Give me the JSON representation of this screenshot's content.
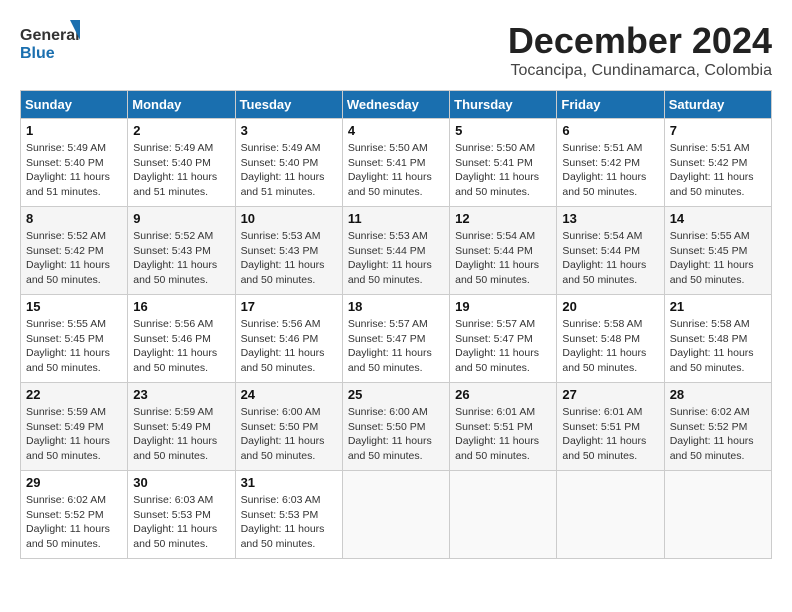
{
  "header": {
    "logo_line1": "General",
    "logo_line2": "Blue",
    "month_title": "December 2024",
    "location": "Tocancipa, Cundinamarca, Colombia"
  },
  "weekdays": [
    "Sunday",
    "Monday",
    "Tuesday",
    "Wednesday",
    "Thursday",
    "Friday",
    "Saturday"
  ],
  "weeks": [
    [
      {
        "day": 1,
        "info": "Sunrise: 5:49 AM\nSunset: 5:40 PM\nDaylight: 11 hours\nand 51 minutes."
      },
      {
        "day": 2,
        "info": "Sunrise: 5:49 AM\nSunset: 5:40 PM\nDaylight: 11 hours\nand 51 minutes."
      },
      {
        "day": 3,
        "info": "Sunrise: 5:49 AM\nSunset: 5:40 PM\nDaylight: 11 hours\nand 51 minutes."
      },
      {
        "day": 4,
        "info": "Sunrise: 5:50 AM\nSunset: 5:41 PM\nDaylight: 11 hours\nand 50 minutes."
      },
      {
        "day": 5,
        "info": "Sunrise: 5:50 AM\nSunset: 5:41 PM\nDaylight: 11 hours\nand 50 minutes."
      },
      {
        "day": 6,
        "info": "Sunrise: 5:51 AM\nSunset: 5:42 PM\nDaylight: 11 hours\nand 50 minutes."
      },
      {
        "day": 7,
        "info": "Sunrise: 5:51 AM\nSunset: 5:42 PM\nDaylight: 11 hours\nand 50 minutes."
      }
    ],
    [
      {
        "day": 8,
        "info": "Sunrise: 5:52 AM\nSunset: 5:42 PM\nDaylight: 11 hours\nand 50 minutes."
      },
      {
        "day": 9,
        "info": "Sunrise: 5:52 AM\nSunset: 5:43 PM\nDaylight: 11 hours\nand 50 minutes."
      },
      {
        "day": 10,
        "info": "Sunrise: 5:53 AM\nSunset: 5:43 PM\nDaylight: 11 hours\nand 50 minutes."
      },
      {
        "day": 11,
        "info": "Sunrise: 5:53 AM\nSunset: 5:44 PM\nDaylight: 11 hours\nand 50 minutes."
      },
      {
        "day": 12,
        "info": "Sunrise: 5:54 AM\nSunset: 5:44 PM\nDaylight: 11 hours\nand 50 minutes."
      },
      {
        "day": 13,
        "info": "Sunrise: 5:54 AM\nSunset: 5:44 PM\nDaylight: 11 hours\nand 50 minutes."
      },
      {
        "day": 14,
        "info": "Sunrise: 5:55 AM\nSunset: 5:45 PM\nDaylight: 11 hours\nand 50 minutes."
      }
    ],
    [
      {
        "day": 15,
        "info": "Sunrise: 5:55 AM\nSunset: 5:45 PM\nDaylight: 11 hours\nand 50 minutes."
      },
      {
        "day": 16,
        "info": "Sunrise: 5:56 AM\nSunset: 5:46 PM\nDaylight: 11 hours\nand 50 minutes."
      },
      {
        "day": 17,
        "info": "Sunrise: 5:56 AM\nSunset: 5:46 PM\nDaylight: 11 hours\nand 50 minutes."
      },
      {
        "day": 18,
        "info": "Sunrise: 5:57 AM\nSunset: 5:47 PM\nDaylight: 11 hours\nand 50 minutes."
      },
      {
        "day": 19,
        "info": "Sunrise: 5:57 AM\nSunset: 5:47 PM\nDaylight: 11 hours\nand 50 minutes."
      },
      {
        "day": 20,
        "info": "Sunrise: 5:58 AM\nSunset: 5:48 PM\nDaylight: 11 hours\nand 50 minutes."
      },
      {
        "day": 21,
        "info": "Sunrise: 5:58 AM\nSunset: 5:48 PM\nDaylight: 11 hours\nand 50 minutes."
      }
    ],
    [
      {
        "day": 22,
        "info": "Sunrise: 5:59 AM\nSunset: 5:49 PM\nDaylight: 11 hours\nand 50 minutes."
      },
      {
        "day": 23,
        "info": "Sunrise: 5:59 AM\nSunset: 5:49 PM\nDaylight: 11 hours\nand 50 minutes."
      },
      {
        "day": 24,
        "info": "Sunrise: 6:00 AM\nSunset: 5:50 PM\nDaylight: 11 hours\nand 50 minutes."
      },
      {
        "day": 25,
        "info": "Sunrise: 6:00 AM\nSunset: 5:50 PM\nDaylight: 11 hours\nand 50 minutes."
      },
      {
        "day": 26,
        "info": "Sunrise: 6:01 AM\nSunset: 5:51 PM\nDaylight: 11 hours\nand 50 minutes."
      },
      {
        "day": 27,
        "info": "Sunrise: 6:01 AM\nSunset: 5:51 PM\nDaylight: 11 hours\nand 50 minutes."
      },
      {
        "day": 28,
        "info": "Sunrise: 6:02 AM\nSunset: 5:52 PM\nDaylight: 11 hours\nand 50 minutes."
      }
    ],
    [
      {
        "day": 29,
        "info": "Sunrise: 6:02 AM\nSunset: 5:52 PM\nDaylight: 11 hours\nand 50 minutes."
      },
      {
        "day": 30,
        "info": "Sunrise: 6:03 AM\nSunset: 5:53 PM\nDaylight: 11 hours\nand 50 minutes."
      },
      {
        "day": 31,
        "info": "Sunrise: 6:03 AM\nSunset: 5:53 PM\nDaylight: 11 hours\nand 50 minutes."
      },
      {
        "day": null,
        "info": ""
      },
      {
        "day": null,
        "info": ""
      },
      {
        "day": null,
        "info": ""
      },
      {
        "day": null,
        "info": ""
      }
    ]
  ]
}
